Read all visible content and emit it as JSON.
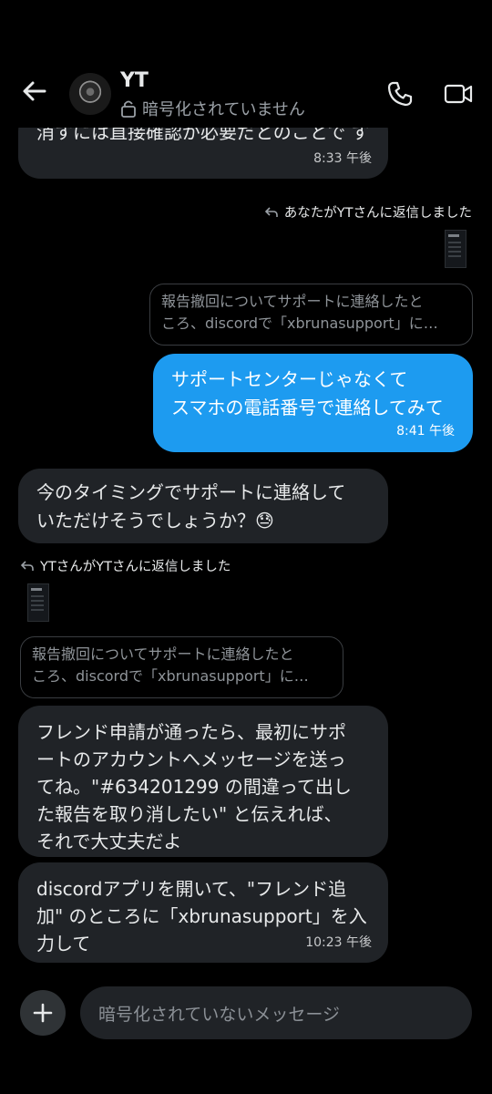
{
  "header": {
    "name": "YT",
    "encryption_status": "暗号化されていません"
  },
  "messages": {
    "m0_text": "消すには直接確認が必要だとのことで す",
    "m0_time": "8:33 午後",
    "reply_note_1": "あなたがYTさんに返信しました",
    "quote_1_line1": "報告撤回についてサポートに連絡したと",
    "quote_1_line2": "ころ、discordで「xbrunasupport」に…",
    "m1_line1": "サポートセンターじゃなくて",
    "m1_line2": "スマホの電話番号で連絡してみて",
    "m1_time": "8:41 午後",
    "m2_line1": "今のタイミングでサポートに連絡して",
    "m2_line2": "いただけそうでしょうか？😓",
    "reply_note_2": "YTさんがYTさんに返信しました",
    "quote_2_line1": "報告撤回についてサポートに連絡したと",
    "quote_2_line2": "ころ、discordで「xbrunasupport」に…",
    "m3_line1": "フレンド申請が通ったら、最初にサポ",
    "m3_line2": "ートのアカウントへメッセージを送っ",
    "m3_line3": "てね。\"#634201299 の間違って出し",
    "m3_line4": "た報告を取り消したい\" と伝えれば、",
    "m3_line5": "それで大丈夫だよ",
    "m4_line1": "discordアプリを開いて、\"フレンド追",
    "m4_line2": "加\" のところに「xbrunasupport」を入",
    "m4_line3": "力して",
    "m4_time": "10:23 午後"
  },
  "composer": {
    "placeholder": "暗号化されていないメッセージ"
  },
  "icons": [
    "back-arrow-icon",
    "lock-icon",
    "phone-icon",
    "video-icon",
    "reply-icon",
    "plus-icon"
  ],
  "colors": {
    "accent": "#1d9bf0",
    "incoming_bubble": "#202327",
    "background": "#000000"
  }
}
